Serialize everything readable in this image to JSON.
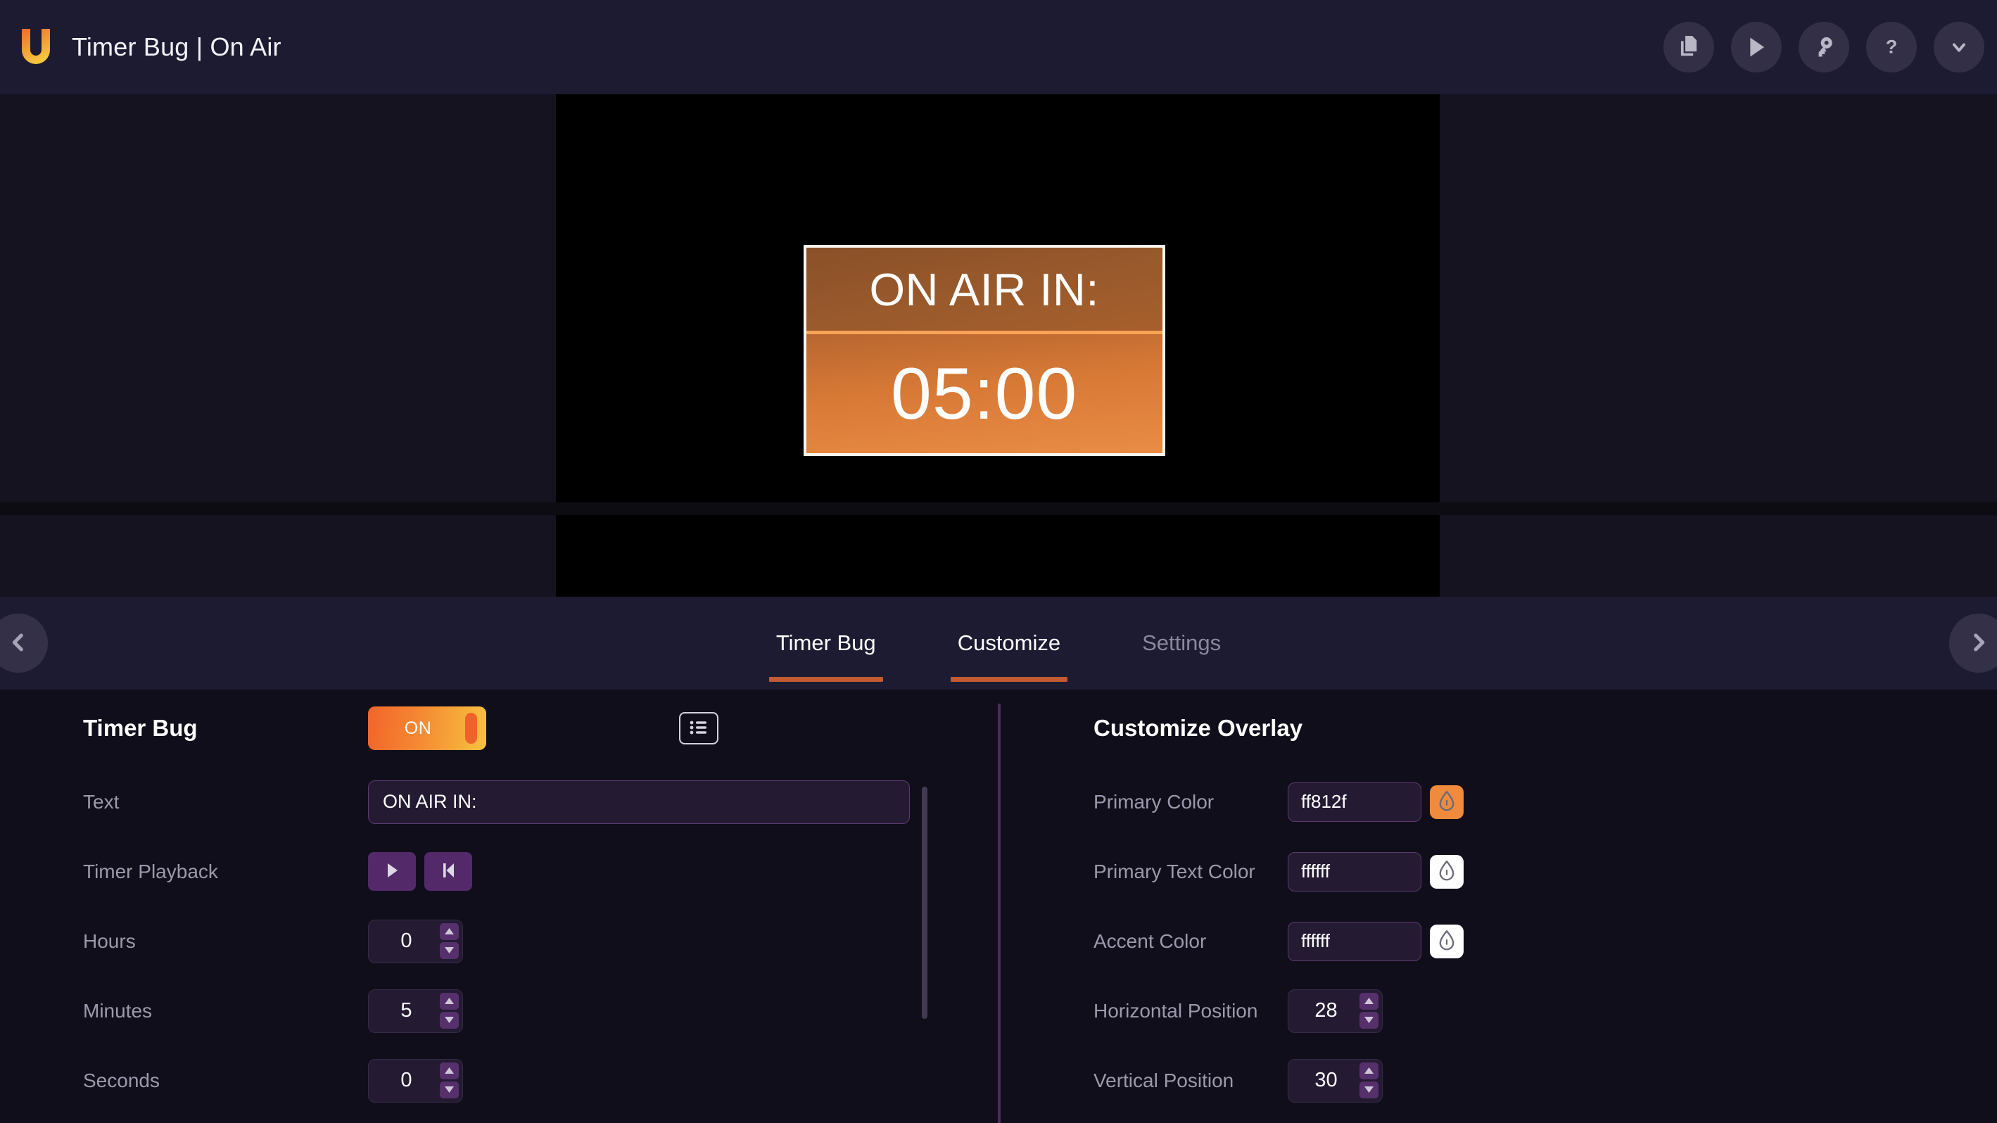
{
  "header": {
    "brand_title": "Timer Bug | On Air",
    "logo_name": "u-logo",
    "actions": [
      {
        "name": "duplicate-icon",
        "label": "Duplicate"
      },
      {
        "name": "play-icon",
        "label": "Play"
      },
      {
        "name": "key-icon",
        "label": "Key"
      },
      {
        "name": "help-icon",
        "label": "Help"
      },
      {
        "name": "chevron-down-icon",
        "label": "More"
      }
    ]
  },
  "preview": {
    "overlay": {
      "title_text": "ON AIR IN:",
      "timer_text": "05:00",
      "border_color": "#fdf6ef",
      "top_bg": "#9a5a2c",
      "bottom_bg": "#d87a36",
      "accent_line": "#f9a356"
    }
  },
  "tabs": {
    "prev_label": "Previous",
    "next_label": "Next",
    "items": [
      {
        "label": "Timer Bug",
        "active": true
      },
      {
        "label": "Customize",
        "active": true
      },
      {
        "label": "Settings",
        "active": false
      }
    ],
    "underline_color": "#c25a32"
  },
  "left_panel": {
    "title": "Timer Bug",
    "toggle": {
      "label": "ON",
      "state": "on"
    },
    "list_button_label": "List",
    "rows": [
      {
        "label": "Text",
        "type": "text",
        "value": "ON AIR IN:"
      },
      {
        "label": "Timer Playback",
        "type": "playback",
        "buttons": [
          {
            "name": "play-icon",
            "label": "Play"
          },
          {
            "name": "skip-to-start-icon",
            "label": "Reset"
          }
        ]
      },
      {
        "label": "Hours",
        "type": "stepper",
        "value": "0"
      },
      {
        "label": "Minutes",
        "type": "stepper",
        "value": "5"
      },
      {
        "label": "Seconds",
        "type": "stepper",
        "value": "0"
      }
    ]
  },
  "right_panel": {
    "title": "Customize Overlay",
    "rows": [
      {
        "label": "Primary Color",
        "type": "color",
        "value": "ff812f",
        "swatch": "#f08a3c"
      },
      {
        "label": "Primary Text Color",
        "type": "color",
        "value": "ffffff",
        "swatch": "#ffffff"
      },
      {
        "label": "Accent Color",
        "type": "color",
        "value": "ffffff",
        "swatch": "#ffffff"
      },
      {
        "label": "Horizontal Position",
        "type": "stepper",
        "value": "28"
      },
      {
        "label": "Vertical Position",
        "type": "stepper",
        "value": "30"
      }
    ]
  }
}
